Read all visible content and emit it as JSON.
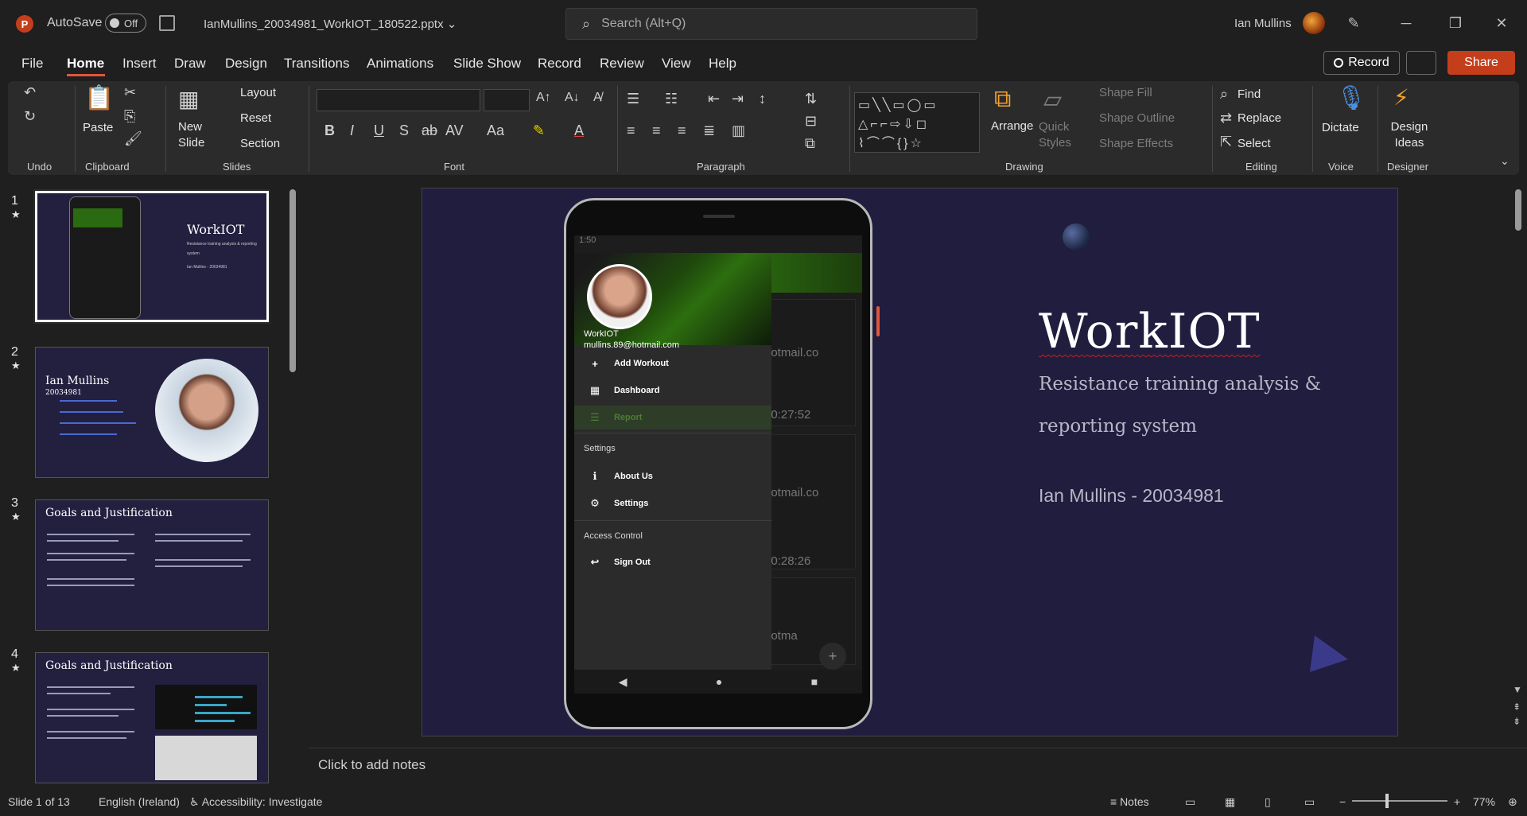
{
  "titlebar": {
    "autosave_label": "AutoSave",
    "autosave_state": "Off",
    "filename": "IanMullins_20034981_WorkIOT_180522.pptx",
    "search_placeholder": "Search (Alt+Q)",
    "user_name": "Ian Mullins",
    "minimize": "─",
    "restore": "❐",
    "close": "✕"
  },
  "tabs": [
    "File",
    "Home",
    "Insert",
    "Draw",
    "Design",
    "Transitions",
    "Animations",
    "Slide Show",
    "Record",
    "Review",
    "View",
    "Help"
  ],
  "active_tab": "Home",
  "actions": {
    "record": "Record",
    "share": "Share"
  },
  "ribbon": {
    "groups": {
      "undo": "Undo",
      "clipboard": "Clipboard",
      "slides": "Slides",
      "font": "Font",
      "paragraph": "Paragraph",
      "drawing": "Drawing",
      "editing": "Editing",
      "voice": "Voice",
      "designer": "Designer"
    },
    "paste": "Paste",
    "new_slide": "New Slide",
    "layout": "Layout",
    "reset": "Reset",
    "section": "Section",
    "arrange": "Arrange",
    "quick_styles": "Quick Styles",
    "shape_fill": "Shape Fill",
    "shape_outline": "Shape Outline",
    "shape_effects": "Shape Effects",
    "find": "Find",
    "replace": "Replace",
    "select": "Select",
    "dictate": "Dictate",
    "design_ideas": "Design Ideas"
  },
  "thumbnails": [
    {
      "num": "1",
      "title": "WorkIOT",
      "sub": "Resistance training analysis & reporting system",
      "author": "Ian Mullins - 20034981"
    },
    {
      "num": "2",
      "title": "Ian Mullins",
      "sub": "20034981"
    },
    {
      "num": "3",
      "title": "Goals and Justification"
    },
    {
      "num": "4",
      "title": "Goals and Justification"
    }
  ],
  "slide": {
    "title": "WorkIOT",
    "subtitle": "Resistance training analysis & reporting system",
    "author": "Ian Mullins - 20034981",
    "phone": {
      "time": "1:50",
      "drawer_name": "WorkIOT",
      "drawer_email": "mullins.89@hotmail.com",
      "menu": [
        {
          "label": "Add Workout",
          "icon": "+"
        },
        {
          "label": "Dashboard",
          "icon": "▦"
        },
        {
          "label": "Report",
          "icon": "☰"
        }
      ],
      "section_settings": "Settings",
      "settings_menu": [
        {
          "label": "About Us",
          "icon": "ℹ"
        },
        {
          "label": "Settings",
          "icon": "⚙"
        }
      ],
      "section_access": "Access Control",
      "sign_out": "Sign Out",
      "cards": [
        {
          "email": "hotmail.co",
          "time": "10:27:52"
        },
        {
          "email": "hotmail.co",
          "time": "10:28:26"
        },
        {
          "email": "hotma"
        }
      ]
    }
  },
  "notes_placeholder": "Click to add notes",
  "status": {
    "slide_count": "Slide 1 of 13",
    "language": "English (Ireland)",
    "accessibility": "Accessibility: Investigate",
    "notes": "Notes",
    "zoom": "77%"
  }
}
